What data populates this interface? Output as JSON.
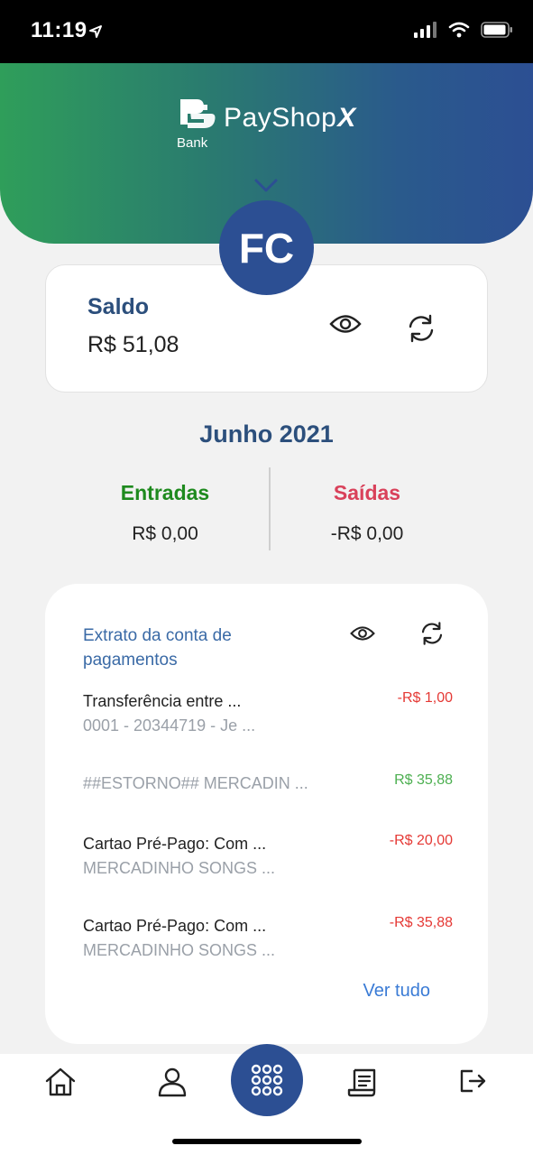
{
  "status": {
    "time": "11:19"
  },
  "brand": {
    "name": "PayShop",
    "suffix": "X",
    "sub": "Bank"
  },
  "avatar": {
    "initials": "FC"
  },
  "saldo": {
    "label": "Saldo",
    "value": "R$ 51,08"
  },
  "month": "Junho 2021",
  "summary": {
    "entradas_label": "Entradas",
    "entradas_value": "R$ 0,00",
    "saidas_label": "Saídas",
    "saidas_value": "-R$ 0,00"
  },
  "extrato": {
    "title": "Extrato da conta de pagamentos",
    "transactions": [
      {
        "desc": "Transferência entre ...",
        "sub": "0001 - 20344719 - Je ...",
        "amount": "-R$ 1,00"
      },
      {
        "desc": "##ESTORNO## MERCADIN ...",
        "sub": "",
        "amount": "R$ 35,88"
      },
      {
        "desc": "Cartao Pré-Pago: Com ...",
        "sub": "MERCADINHO SONGS ...",
        "amount": "-R$ 20,00"
      },
      {
        "desc": "Cartao Pré-Pago: Com ...",
        "sub": "MERCADINHO SONGS ...",
        "amount": "-R$ 35,88"
      }
    ],
    "ver_tudo": "Ver tudo"
  },
  "colors": {
    "primary": "#2c4f93",
    "positive": "#4caf50",
    "negative": "#e53935",
    "entradas": "#1e8a1e",
    "saidas": "#d9415a"
  },
  "nav": {
    "icons": [
      "home-icon",
      "profile-icon",
      "apps-grid-icon",
      "receipt-icon",
      "logout-icon"
    ]
  }
}
